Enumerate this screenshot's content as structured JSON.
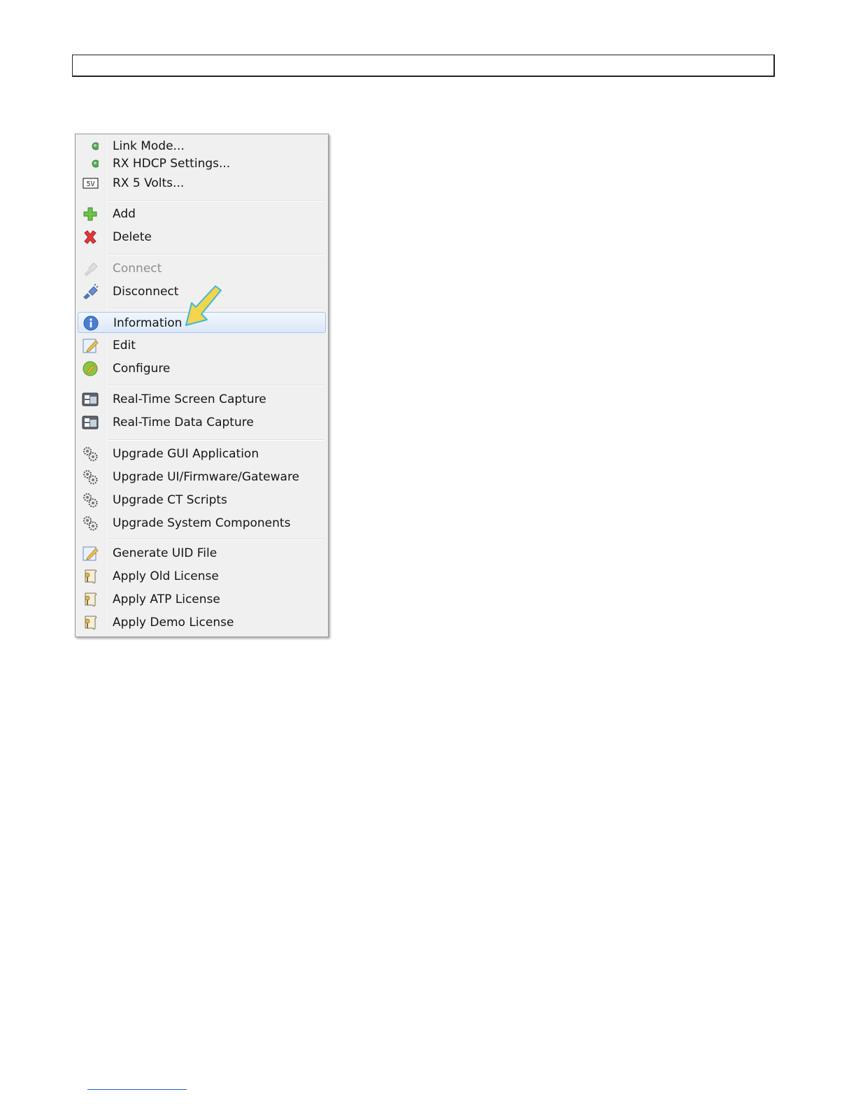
{
  "colors": {
    "menu_background": "#f0f0f0",
    "highlight_border": "#a8c7ee",
    "disabled_text": "#8e8e8e",
    "callout_arrow": "#f5d54c",
    "callout_arrow_outline": "#3fb8d6"
  },
  "context_menu": {
    "items": [
      {
        "label": "Link Mode...",
        "icon": "green-dot-icon",
        "enabled": true
      },
      {
        "label": "RX HDCP Settings...",
        "icon": "green-dot-icon",
        "enabled": true
      },
      {
        "label": "RX 5 Volts...",
        "icon": "five-volt-icon",
        "icon_text": "5V",
        "enabled": true
      },
      {
        "label": "Add",
        "icon": "plus-icon",
        "enabled": true
      },
      {
        "label": "Delete",
        "icon": "delete-x-icon",
        "enabled": true
      },
      {
        "label": "Connect",
        "icon": "plug-icon",
        "enabled": false
      },
      {
        "label": "Disconnect",
        "icon": "unplug-icon",
        "enabled": true
      },
      {
        "label": "Information",
        "icon": "info-icon",
        "enabled": true,
        "highlighted": true
      },
      {
        "label": "Edit",
        "icon": "edit-icon",
        "enabled": true
      },
      {
        "label": "Configure",
        "icon": "configure-icon",
        "enabled": true
      },
      {
        "label": "Real-Time Screen Capture",
        "icon": "capture-icon",
        "enabled": true
      },
      {
        "label": "Real-Time Data Capture",
        "icon": "capture-icon",
        "enabled": true
      },
      {
        "label": "Upgrade GUI Application",
        "icon": "gears-icon",
        "enabled": true
      },
      {
        "label": "Upgrade UI/Firmware/Gateware",
        "icon": "gears-icon",
        "enabled": true
      },
      {
        "label": "Upgrade CT Scripts",
        "icon": "gears-icon",
        "enabled": true
      },
      {
        "label": "Upgrade System Components",
        "icon": "gears-icon",
        "enabled": true
      },
      {
        "label": "Generate UID File",
        "icon": "edit-icon",
        "enabled": true
      },
      {
        "label": "Apply Old License",
        "icon": "license-icon",
        "enabled": true
      },
      {
        "label": "Apply ATP License",
        "icon": "license-icon",
        "enabled": true
      },
      {
        "label": "Apply Demo License",
        "icon": "license-icon",
        "enabled": true
      }
    ]
  }
}
